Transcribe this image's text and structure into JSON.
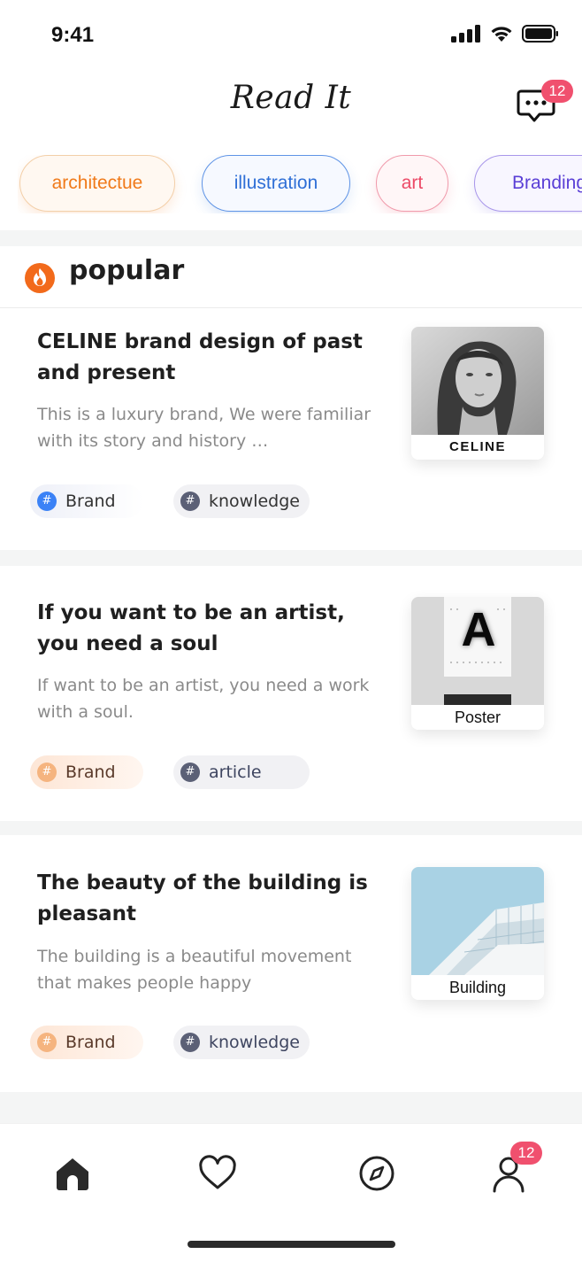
{
  "status_bar": {
    "time": "9:41"
  },
  "header": {
    "title": "Read It",
    "message_badge": "12"
  },
  "chips": [
    {
      "label": "architectue",
      "color": "#f07a1a"
    },
    {
      "label": "illustration",
      "color": "#2f6fd6"
    },
    {
      "label": "art",
      "color": "#ec4a67"
    },
    {
      "label": "Branding",
      "color": "#5a3fd6"
    }
  ],
  "section": {
    "title": "popular"
  },
  "articles": [
    {
      "title": "CELINE brand design of past and present",
      "description": "This is a luxury brand, We were familiar with its story and history …",
      "thumb_caption": "CELINE",
      "tags": [
        "Brand",
        "knowledge"
      ]
    },
    {
      "title": "If you want to be an artist, you need a soul",
      "description": "If  want to be an artist, you need a work with a soul.",
      "thumb_caption": "Poster",
      "poster_letter": "A",
      "tags": [
        "Brand",
        "article"
      ]
    },
    {
      "title": "The beauty of the building is pleasant",
      "description": "The building is a beautiful movement that makes people happy",
      "thumb_caption": "Building",
      "tags": [
        "Brand",
        "knowledge"
      ]
    }
  ],
  "tabbar": {
    "items": [
      {
        "icon": "home-icon"
      },
      {
        "icon": "heart-icon"
      },
      {
        "icon": "compass-icon"
      },
      {
        "icon": "profile-icon"
      }
    ],
    "profile_badge": "12"
  }
}
